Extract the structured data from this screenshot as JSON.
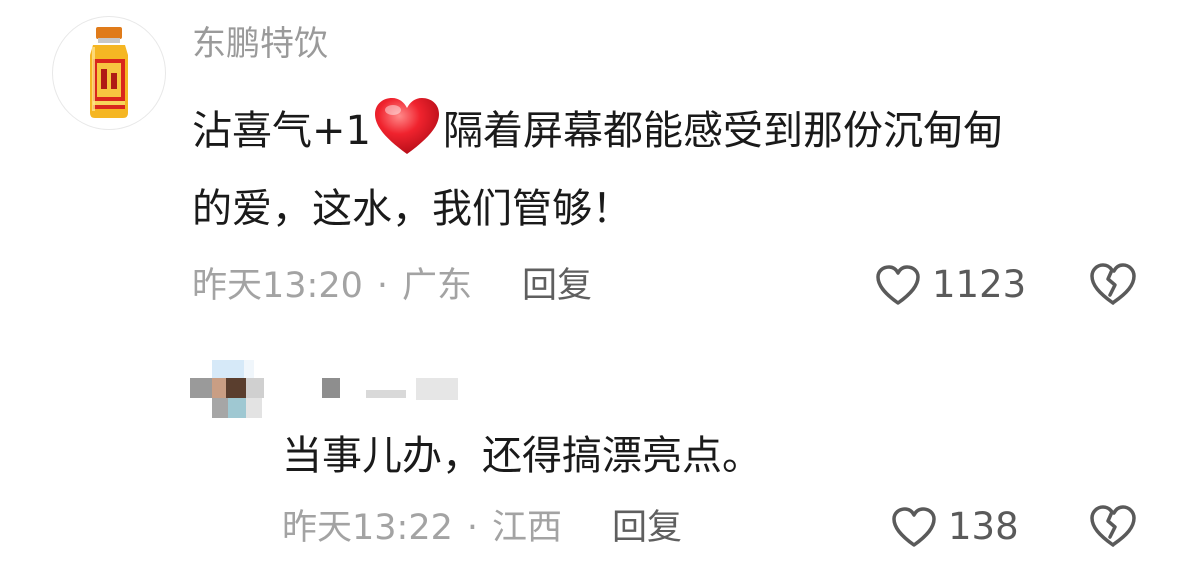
{
  "comment": {
    "avatar_icon": "drink-bottle-avatar",
    "username": "东鹏特饮",
    "text_part1": "沾喜气+1",
    "emoji": "red-heart-icon",
    "text_part2": "隔着屏幕都能感受到那份沉甸甸",
    "text_line2": "的爱，这水，我们管够！",
    "time": "昨天13:20",
    "separator": "·",
    "location": "广东",
    "reply_label": "回复",
    "like_count": "1123",
    "like_icon": "heart-outline-icon",
    "dislike_icon": "broken-heart-icon"
  },
  "reply": {
    "avatar_icon": "pixelated-avatar",
    "text": "当事儿办，还得搞漂亮点。",
    "time": "昨天13:22",
    "separator": "·",
    "location": "江西",
    "reply_label": "回复",
    "like_count": "138",
    "like_icon": "heart-outline-icon",
    "dislike_icon": "broken-heart-icon"
  },
  "colors": {
    "text_primary": "#1a1a1a",
    "text_secondary": "#a3a3a3",
    "reply_action": "#5f5f5f",
    "heart_red": "#e8202f"
  }
}
